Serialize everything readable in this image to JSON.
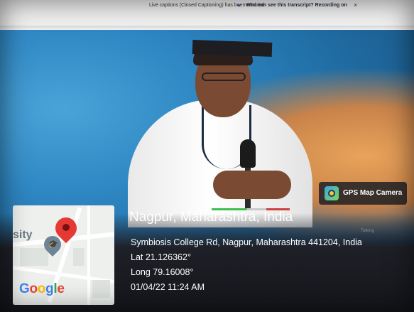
{
  "projected_screen": {
    "caption_notice": "Live captions (Closed Captioning) has been enabled",
    "transcript_link": "Who can see this transcript? Recording on",
    "close_glyph": "×",
    "talking_label": "Talking"
  },
  "gps_badge": {
    "label": "GPS Map Camera",
    "icon": "gps-map-camera-icon"
  },
  "map": {
    "place_label": "sity",
    "provider_logo": {
      "letters": [
        "G",
        "o",
        "o",
        "g",
        "l",
        "e"
      ],
      "colors": [
        "#4285f4",
        "#ea4335",
        "#fbbc05",
        "#4285f4",
        "#34a853",
        "#ea4335"
      ]
    },
    "pin_color": "#e53935"
  },
  "location": {
    "title": "Nagpur, Maharashtra, India",
    "address": "Symbiosis College Rd, Nagpur, Maharashtra 441204, India",
    "lat": "Lat 21.126362°",
    "long": "Long 79.16008°",
    "datetime": "01/04/22 11:24 AM"
  }
}
